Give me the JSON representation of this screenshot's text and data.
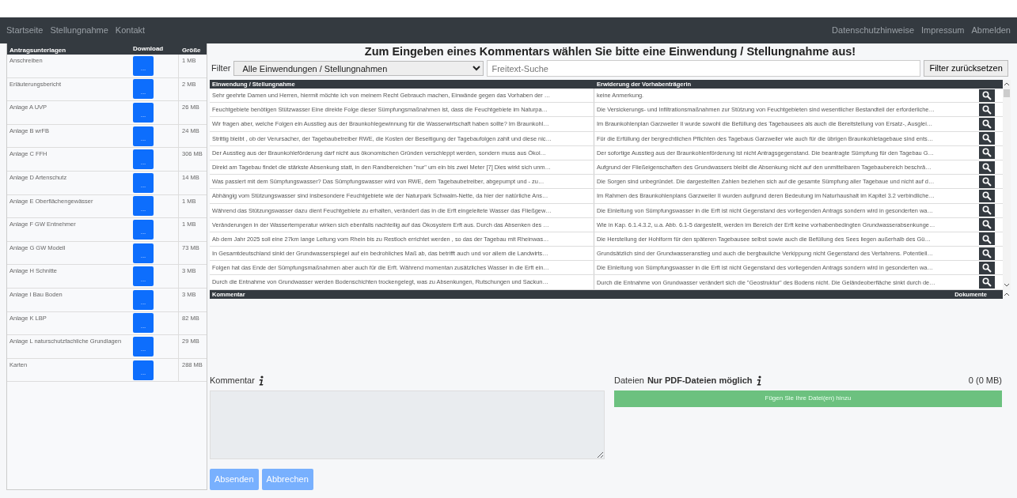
{
  "nav": {
    "left": [
      "Startseite",
      "Stellungnahme",
      "Kontakt"
    ],
    "right": [
      "Datenschutzhinweise",
      "Impressum",
      "Abmelden"
    ]
  },
  "documents": {
    "columns": [
      "Antragsunterlagen",
      "Download",
      "Größe"
    ],
    "rows": [
      {
        "name": "Anschreiben",
        "button": "...",
        "size": "1 MB"
      },
      {
        "name": "Erläuterungsbericht",
        "button": "...",
        "size": "2 MB"
      },
      {
        "name": "Anlage A UVP",
        "button": "...",
        "size": "26 MB"
      },
      {
        "name": "Anlage B wrFB",
        "button": "...",
        "size": "24 MB"
      },
      {
        "name": "Anlage C FFH",
        "button": "...",
        "size": "306 MB"
      },
      {
        "name": "Anlage D Artenschutz",
        "button": "...",
        "size": "14 MB"
      },
      {
        "name": "Anlage E Oberflächengewässer",
        "button": "...",
        "size": "1 MB"
      },
      {
        "name": "Anlage F GW Entnehmer",
        "button": "...",
        "size": "1 MB"
      },
      {
        "name": "Anlage G GW Modell",
        "button": "...",
        "size": "73 MB"
      },
      {
        "name": "Anlage H Schnitte",
        "button": "...",
        "size": "3 MB"
      },
      {
        "name": "Anlage I Bau Boden",
        "button": "...",
        "size": "3 MB"
      },
      {
        "name": "Anlage K LBP",
        "button": "...",
        "size": "82 MB"
      },
      {
        "name": "Anlage L naturschutzfachliche Grundlagen",
        "button": "...",
        "size": "29 MB"
      },
      {
        "name": "Karten",
        "button": "...",
        "size": "288 MB"
      }
    ]
  },
  "heading": "Zum Eingeben eines Kommentars wählen Sie bitte eine Einwendung / Stellungnahme aus!",
  "filter": {
    "label": "Filter",
    "value": "Alle Einwendungen / Stellungnahmen",
    "search_placeholder": "Freitext-Suche",
    "reset": "Filter zurücksetzen"
  },
  "table": {
    "columns": [
      "Einwendung / Stellungnahme",
      "Erwiderung der Vorhabenträgerin"
    ],
    "rows": [
      {
        "objection": "Sehr geehrte Damen und Herren, hiermit möchte ich von meinem Recht Gebrauch machen, Einwände gegen das Vorhaben der …",
        "reply": "keine Anmerkung."
      },
      {
        "objection": "Feuchtgebiete benötigen Stützwasser Eine direkte Folge dieser Sümpfungsmaßnahmen ist, dass die Feuchtgebiete im Naturpa…",
        "reply": "Die Versickerungs- und Infiltrationsmaßnahmen zur Stützung von Feuchtgebieten sind wesentlicher Bestandteil der erforderliche…"
      },
      {
        "objection": "Wir fragen aber, welche Folgen ein Ausstieg aus der Braunkohlegewinnung für die Wasserwirtschaft haben sollte? Im Braunkohl…",
        "reply": "Im Braunkohlenplan Garzweiler II wurde sowohl die Befüllung des Tagebausees als auch die Bereitstellung von Ersatz-, Ausglei…"
      },
      {
        "objection": "Strittig bleibt , ob der Verursacher, der Tagebaubetreiber RWE, die Kosten der Beseitigung der Tagebaufolgen zahlt und diese nic…",
        "reply": "Für die Erfüllung der bergrechtlichen Pflichten des Tagebaus Garzweiler wie auch für die übrigen Braunkohletagebaue sind ents…"
      },
      {
        "objection": "Der Ausstieg aus der Braunkohleförderung darf nicht aus ökonomischen Gründen verschleppt werden, sondern muss aus Ökol…",
        "reply": "Der sofortige Ausstieg aus der Braunkohlenförderung ist nicht Antragsgegenstand. Die beantragte Sümpfung für den Tagebau G…"
      },
      {
        "objection": "Direkt am Tagebau findet die stärkste Absenkung statt, in den Randbereichen \"nur\" um ein bis zwei Meter [7] Dies wirkt sich unm…",
        "reply": "Aufgrund der Fließeigenschaften des Grundwassers bleibt die Absenkung nicht auf den unmittelbaren Tagebaubereich beschrä…"
      },
      {
        "objection": "Was passiert mit dem Sümpfungswasser? Das Sümpfungswasser wird von RWE, dem Tagebaubetreiber, abgepumpt und - zu…",
        "reply": "Die Sorgen sind unbegründet. Die dargestellten Zahlen beziehen sich auf die gesamte Sümpfung aller Tagebaue und nicht auf d…"
      },
      {
        "objection": "Abhängig vom Stützungswasser sind insbesondere Feuchtgebiete wie der Naturpark Schwalm-Nette, da hier der natürliche Ans…",
        "reply": "Im Rahmen des Braunkohlenplans Garzweiler II wurden aufgrund deren Bedeutung im Naturhaushalt im Kapitel 3.2 verbindliche…"
      },
      {
        "objection": "Während das Stützungswasser dazu dient Feuchtgebiete zu erhalten, verändert das in die Erft eingeleitete Wasser das Fließgew…",
        "reply": "Die Einleitung von Sümpfungswasser in die Erft ist nicht Gegenstand des vorliegenden Antrags sondern wird in gesonderten wa…"
      },
      {
        "objection": "Veränderungen in der Wassertemperatur wirken sich ebenfalls nachteilig auf das Ökosystem Erft aus. Durch das Absenken des …",
        "reply": "Wie in Kap. 6.1.4.3.2, u.a. Abb. 6.1-5 dargestellt, werden im Bereich der Erft keine vorhabenbedingten Grundwasserabsenkunge…"
      },
      {
        "objection": "Ab dem Jahr 2025 soll eine 27km lange Leitung vom Rhein bis zu Restloch errichtet werden , so das der Tagebau mit Rheinwas…",
        "reply": "Die Herstellung der Hohlform für den späteren Tagebausee selbst sowie auch die Befüllung des Sees liegen außerhalb des Gü…"
      },
      {
        "objection": "In Gesamtdeutschland sinkt der Grundwasserspiegel auf ein bedrohliches Maß ab, das betrifft auch und vor allem die Landwirts…",
        "reply": "Grundsätzlich sind der Grundwasseranstieg und auch die bergbauliche Verkippung nicht Gegenstand des Verfahrens. Potentiell…"
      },
      {
        "objection": "Folgen hat das Ende der Sümpfungsmaßnahmen aber auch für die Erft. Während momentan zusätzliches Wasser in die Erft ein…",
        "reply": "Die Einleitung von Sümpfungswasser in die Erft ist nicht Gegenstand des vorliegenden Antrags sondern wird in gesonderten wa…"
      },
      {
        "objection": "Durch die Entnahme von Grundwasser werden Bodenschichten trockengelegt, was zu Absenkungen, Rutschungen und Sackun…",
        "reply": "Durch die Entnahme von Grundwasser verändert sich die \"Geostruktur\" des Bodens nicht. Die Geländeoberfläche sinkt durch de…"
      }
    ]
  },
  "comments_table": {
    "columns": [
      "Kommentar",
      "Dokumente"
    ]
  },
  "comment": {
    "label": "Kommentar",
    "disabled": true
  },
  "files": {
    "label": "Dateien",
    "note": "Nur PDF-Dateien möglich",
    "count": "0 (0 MB)",
    "add_button": "Fügen Sie Ihre Datei(en) hinzu"
  },
  "actions": [
    {
      "label": "Absenden",
      "disabled": true
    },
    {
      "label": "Abbrechen",
      "disabled": true
    }
  ]
}
